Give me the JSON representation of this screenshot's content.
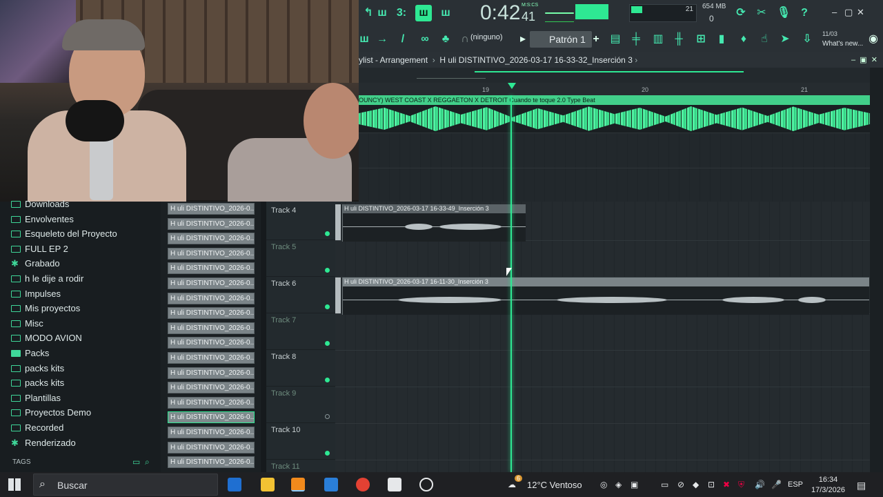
{
  "toolbar": {
    "time": "0:42",
    "time_sub": "41",
    "time_label": "M:S:CS",
    "cpu_value": "21",
    "memory": "654 MB",
    "memory_sub": "0",
    "pattern_none": "(ninguno)",
    "pattern": "Patrón 1",
    "news_date": "11/03",
    "news": "What's new..."
  },
  "playlist": {
    "header_prefix": "ylist - Arrangement",
    "header_sep": "›",
    "header_title": "H uli DISTINTIVO_2026-03-17 16-33-32_Inserción 3",
    "ruler": [
      "19",
      "20",
      "21"
    ],
    "top_clip_title": "OUNCY) WEST COAST X REGGAETON X DETROIT Cuando te toque 2.0 Type Beat"
  },
  "browser": {
    "folders": [
      {
        "label": "Downloads",
        "icon": "folder-icon"
      },
      {
        "label": "Envolventes",
        "icon": "folder-icon"
      },
      {
        "label": "Esqueleto del Proyecto",
        "icon": "folder-icon"
      },
      {
        "label": "FULL EP 2",
        "icon": "folder-icon"
      },
      {
        "label": "Grabado",
        "icon": "star-icon"
      },
      {
        "label": "h le dije a rodir",
        "icon": "folder-icon"
      },
      {
        "label": "Impulses",
        "icon": "folder-icon"
      },
      {
        "label": "Mis proyectos",
        "icon": "folder-icon"
      },
      {
        "label": "Misc",
        "icon": "folder-icon"
      },
      {
        "label": "MODO AVION",
        "icon": "folder-icon"
      },
      {
        "label": "Packs",
        "icon": "packs-icon"
      },
      {
        "label": "packs kits",
        "icon": "folder-icon"
      },
      {
        "label": "packs kits",
        "icon": "folder-icon"
      },
      {
        "label": "Plantillas",
        "icon": "folder-icon"
      },
      {
        "label": "Proyectos Demo",
        "icon": "folder-icon"
      },
      {
        "label": "Recorded",
        "icon": "folder-icon"
      },
      {
        "label": "Renderizado",
        "icon": "star-icon"
      }
    ],
    "tags_label": "TAGS"
  },
  "patterns": {
    "label": "H uli DISTINTIVO_2026-0...",
    "count": 18,
    "selected_index": 14
  },
  "tracks": [
    {
      "name": "Track 4",
      "active": true
    },
    {
      "name": "Track 5",
      "active": true
    },
    {
      "name": "Track 6",
      "active": true
    },
    {
      "name": "Track 7",
      "active": true
    },
    {
      "name": "Track 8",
      "active": true
    },
    {
      "name": "Track 9",
      "active": false
    },
    {
      "name": "Track 10",
      "active": true
    },
    {
      "name": "Track 11",
      "active": true
    }
  ],
  "clips": {
    "track4": "H uli DISTINTIVO_2026-03-17 16-33-49_Inserción 3",
    "track6": "H uli DISTINTIVO_2026-03-17 16-11-30_Inserción 3"
  },
  "taskbar": {
    "search_placeholder": "Buscar",
    "weather": "12°C  Ventoso",
    "lang": "ESP",
    "time": "16:34",
    "date": "17/3/2026",
    "notification_badge": "6"
  },
  "colors": {
    "accent": "#2ee893",
    "panel": "#1d2125"
  }
}
